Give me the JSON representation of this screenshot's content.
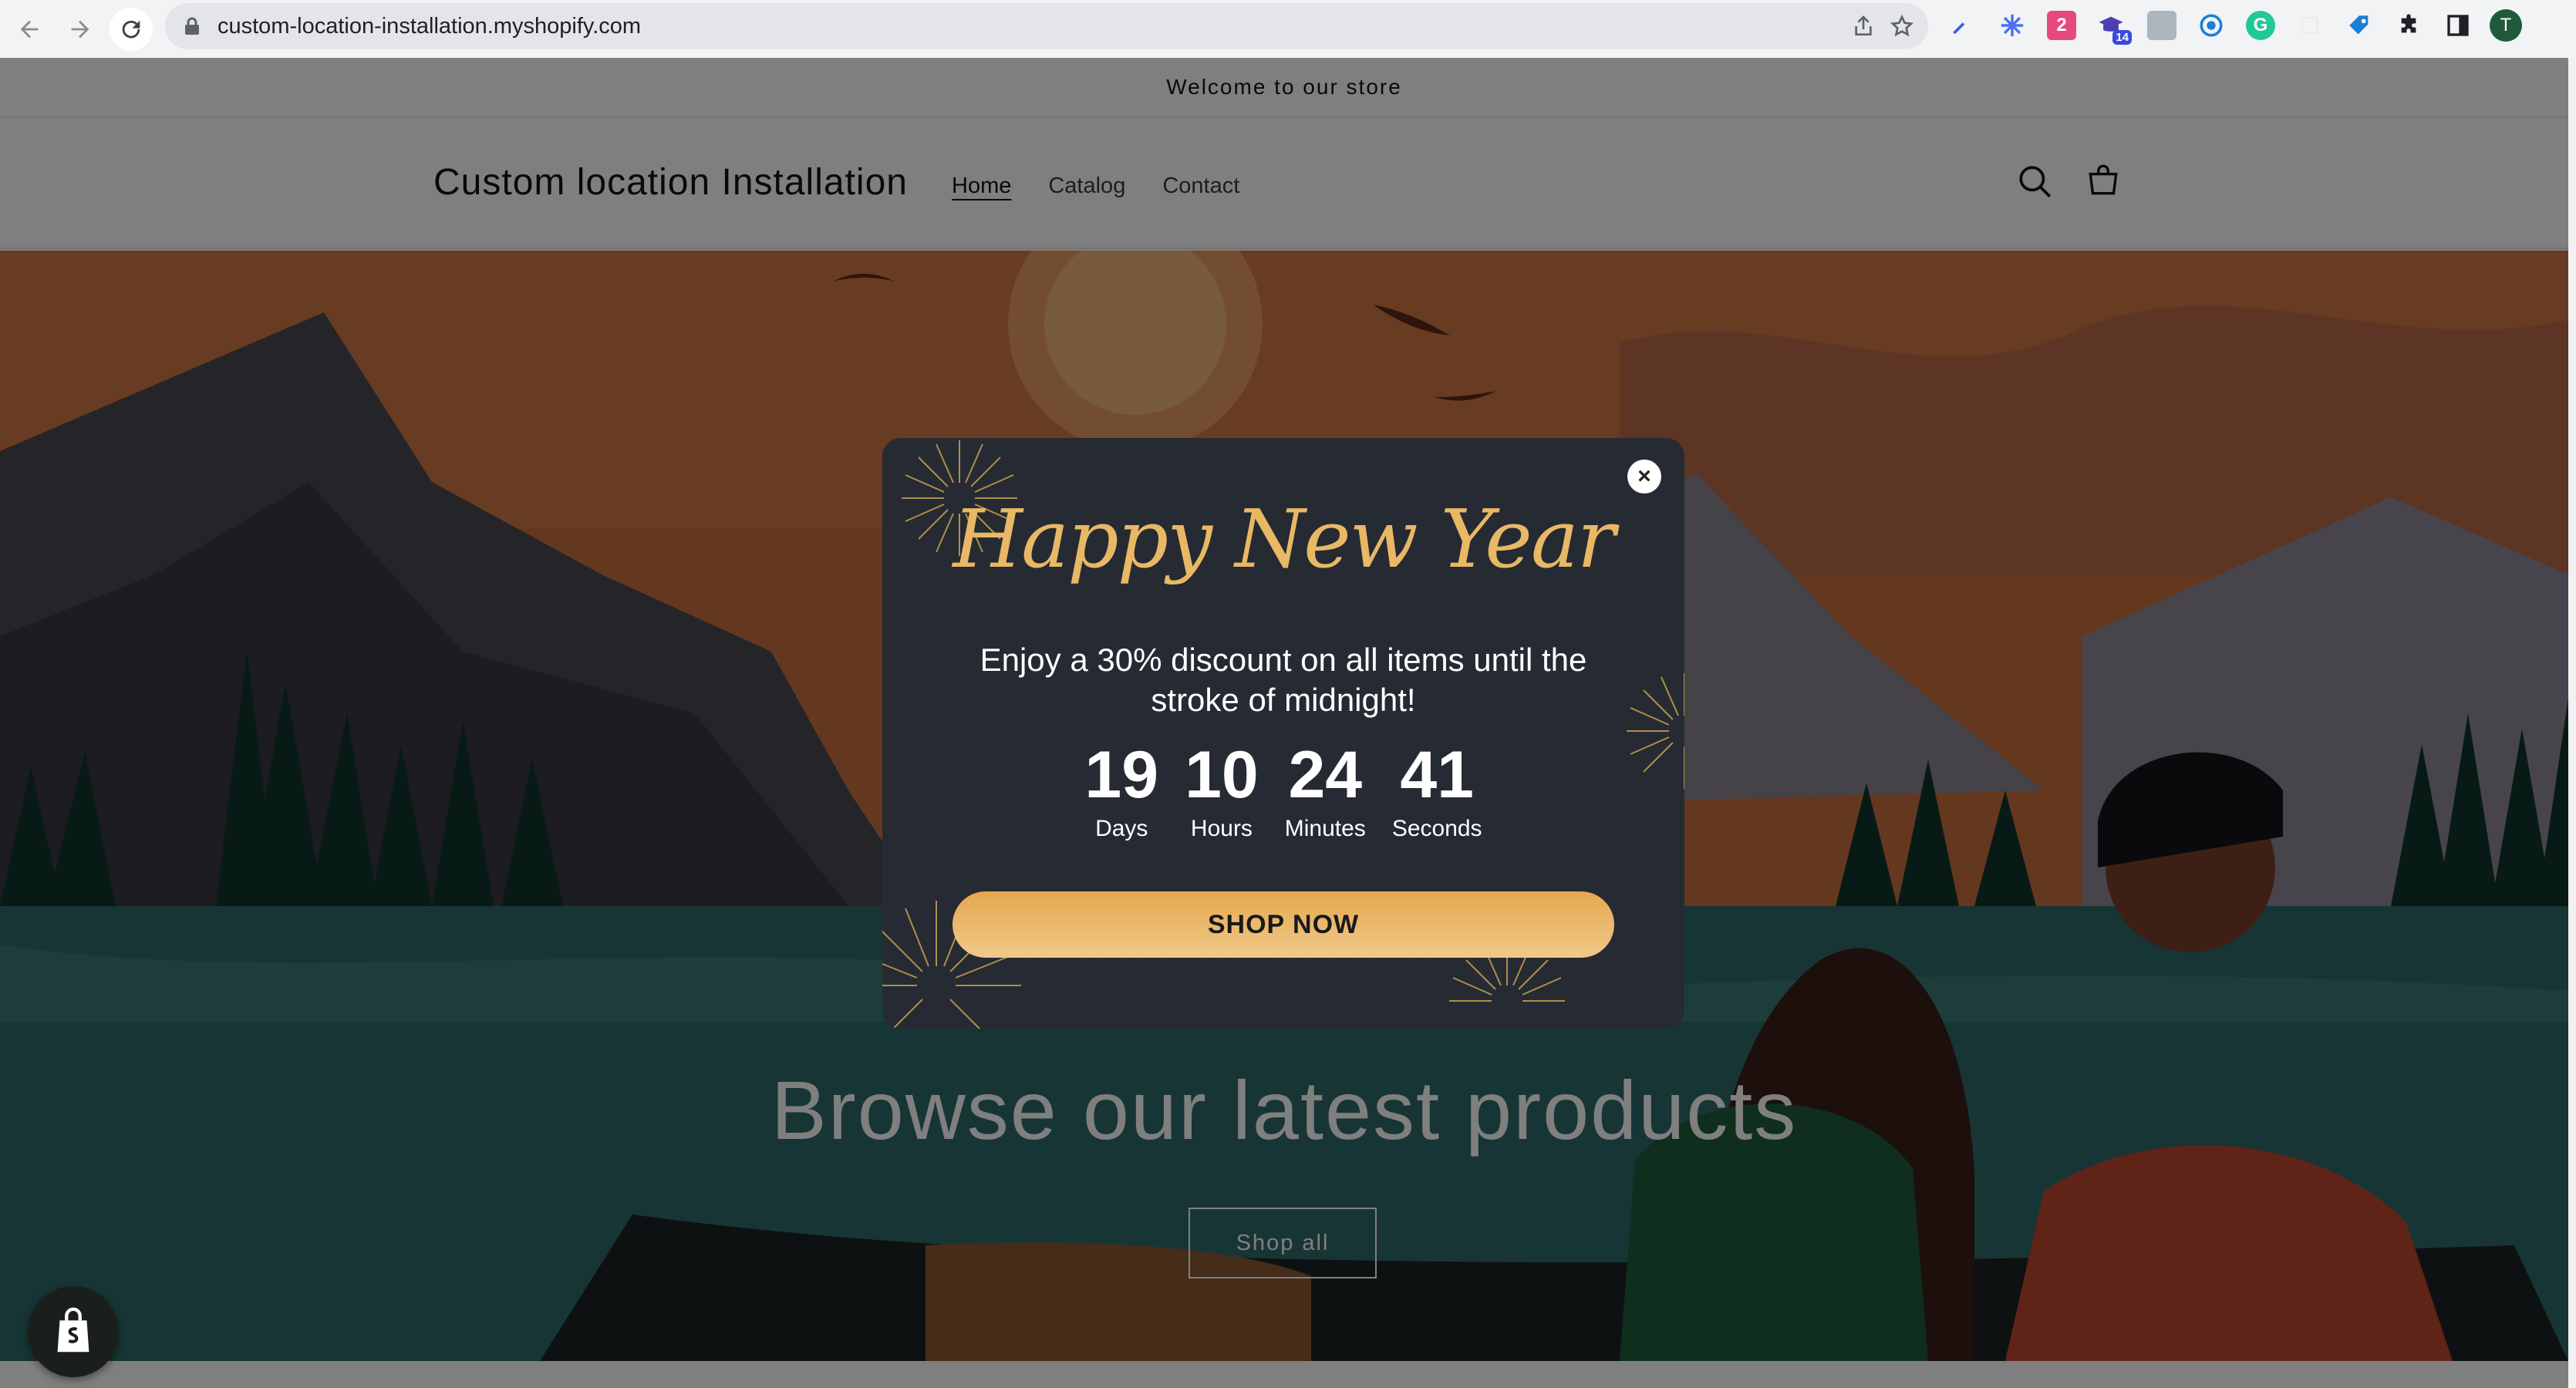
{
  "browser": {
    "url": "custom-location-installation.myshopify.com",
    "profile_initial": "T",
    "extension_badge": "14"
  },
  "store": {
    "announcement": "Welcome to our store",
    "brand": "Custom location Installation",
    "nav": [
      "Home",
      "Catalog",
      "Contact"
    ]
  },
  "hero": {
    "title": "Browse our latest products",
    "button_label": "Shop all"
  },
  "popup": {
    "title": "Happy New Year",
    "offer": "Enjoy a 30% discount on all items until the stroke of midnight!",
    "countdown": [
      {
        "value": "19",
        "label": "Days"
      },
      {
        "value": "10",
        "label": "Hours"
      },
      {
        "value": "24",
        "label": "Minutes"
      },
      {
        "value": "41",
        "label": "Seconds"
      }
    ],
    "cta": "SHOP NOW",
    "close_glyph": "×"
  },
  "colors": {
    "popup_bg": "#262a33",
    "gold": "#e9b865",
    "cta_gradient_start": "#e5a84e",
    "cta_gradient_end": "#f0c98a"
  }
}
